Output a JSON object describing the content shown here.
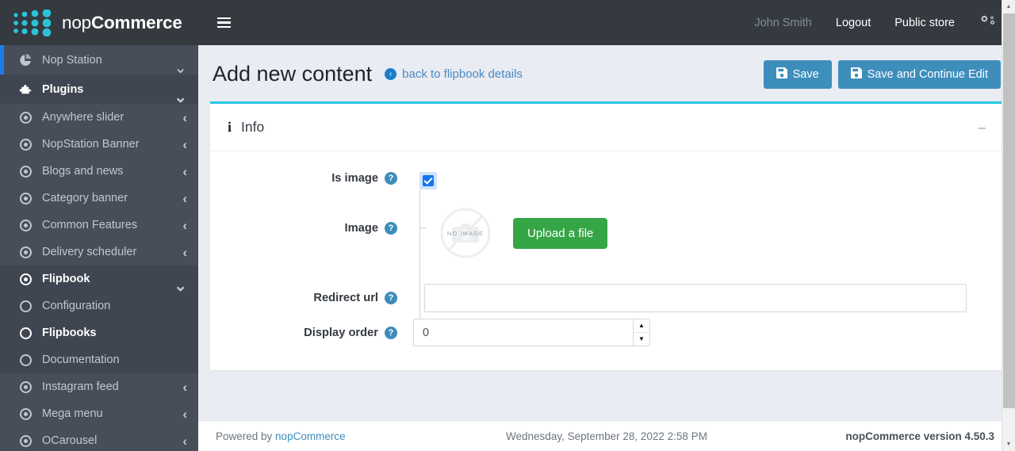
{
  "brand": {
    "name_light": "nop",
    "name_bold": "Commerce",
    "logo_icon": "nopcommerce-dots-logo"
  },
  "topbar": {
    "menu_toggle_icon": "hamburger-icon",
    "user": "John Smith",
    "logout": "Logout",
    "public_store": "Public store",
    "settings_icon": "gears-icon"
  },
  "sidebar": {
    "items": [
      {
        "label": "Nop Station",
        "icon": "pie-chart-icon",
        "caret": "chevron-down",
        "level": 0,
        "active": true,
        "bold": false,
        "shaded": false
      },
      {
        "label": "Plugins",
        "icon": "puzzle-piece-icon",
        "caret": "chevron-down",
        "level": 0,
        "active": false,
        "bold": true,
        "shaded": true
      },
      {
        "label": "Anywhere slider",
        "icon": "dot-circle-icon",
        "caret": "chevron-left",
        "level": 1,
        "active": false,
        "bold": false,
        "shaded": false
      },
      {
        "label": "NopStation Banner",
        "icon": "dot-circle-icon",
        "caret": "chevron-left",
        "level": 1,
        "active": false,
        "bold": false,
        "shaded": false
      },
      {
        "label": "Blogs and news",
        "icon": "dot-circle-icon",
        "caret": "chevron-left",
        "level": 1,
        "active": false,
        "bold": false,
        "shaded": false
      },
      {
        "label": "Category banner",
        "icon": "dot-circle-icon",
        "caret": "chevron-left",
        "level": 1,
        "active": false,
        "bold": false,
        "shaded": false
      },
      {
        "label": "Common Features",
        "icon": "dot-circle-icon",
        "caret": "chevron-left",
        "level": 1,
        "active": false,
        "bold": false,
        "shaded": false
      },
      {
        "label": "Delivery scheduler",
        "icon": "dot-circle-icon",
        "caret": "chevron-left",
        "level": 1,
        "active": false,
        "bold": false,
        "shaded": false
      },
      {
        "label": "Flipbook",
        "icon": "dot-circle-icon",
        "caret": "chevron-down",
        "level": 1,
        "active": false,
        "bold": true,
        "shaded": true
      },
      {
        "label": "Configuration",
        "icon": "circle-icon",
        "caret": "",
        "level": 2,
        "active": false,
        "bold": false,
        "shaded": true
      },
      {
        "label": "Flipbooks",
        "icon": "circle-icon",
        "caret": "",
        "level": 2,
        "active": false,
        "bold": true,
        "shaded": true
      },
      {
        "label": "Documentation",
        "icon": "circle-icon",
        "caret": "",
        "level": 2,
        "active": false,
        "bold": false,
        "shaded": true
      },
      {
        "label": "Instagram feed",
        "icon": "dot-circle-icon",
        "caret": "chevron-left",
        "level": 1,
        "active": false,
        "bold": false,
        "shaded": false
      },
      {
        "label": "Mega menu",
        "icon": "dot-circle-icon",
        "caret": "chevron-left",
        "level": 1,
        "active": false,
        "bold": false,
        "shaded": false
      },
      {
        "label": "OCarousel",
        "icon": "dot-circle-icon",
        "caret": "chevron-left",
        "level": 1,
        "active": false,
        "bold": false,
        "shaded": false
      }
    ]
  },
  "page": {
    "title": "Add new content",
    "back_link": "back to flipbook details",
    "back_icon": "arrow-circle-left-icon",
    "save_label": "Save",
    "save_continue_label": "Save and Continue Edit",
    "save_icon": "floppy-disk-icon"
  },
  "panel": {
    "title": "Info",
    "title_icon": "info-icon",
    "collapse_icon": "minus-icon",
    "accent_color": "#2ac7e1"
  },
  "form": {
    "is_image": {
      "label": "Is image",
      "help_icon": "question-circle-icon",
      "checked": true
    },
    "image": {
      "label": "Image",
      "help_icon": "question-circle-icon",
      "placeholder_text": "NO IMAGE",
      "upload_label": "Upload a file"
    },
    "redirect_url": {
      "label": "Redirect url",
      "help_icon": "question-circle-icon",
      "value": "",
      "placeholder": ""
    },
    "display_order": {
      "label": "Display order",
      "help_icon": "question-circle-icon",
      "value": "0",
      "placeholder": ""
    }
  },
  "footer": {
    "powered_by_prefix": "Powered by ",
    "powered_by_link": "nopCommerce",
    "datetime": "Wednesday, September 28, 2022 2:58 PM",
    "version": "nopCommerce version 4.50.3"
  },
  "colors": {
    "sidebar_bg": "#474e5a",
    "topbar_bg": "#343a40",
    "accent_blue": "#3e8ebc",
    "accent_cyan": "#2ac7e1",
    "success_green": "#36a546",
    "content_bg": "#e9ecf2"
  }
}
